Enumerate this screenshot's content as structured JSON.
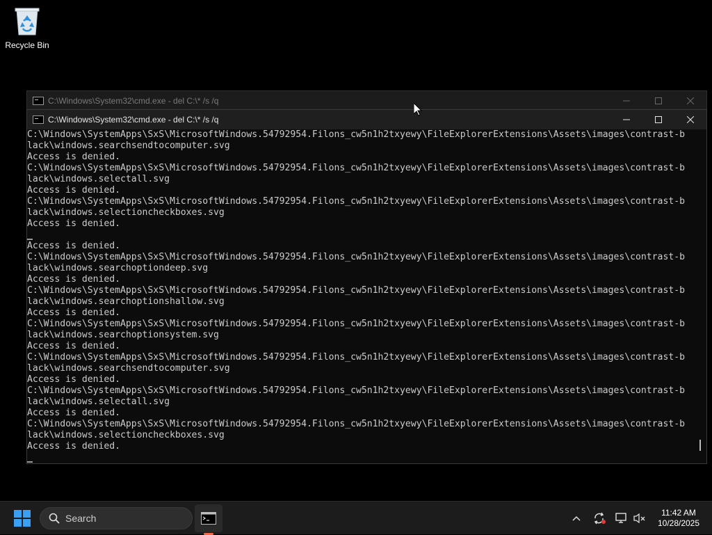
{
  "desktop": {
    "recycle_bin_label": "Recycle Bin"
  },
  "back_window": {
    "title": "C:\\Windows\\System32\\cmd.exe - del  C:\\* /s /q"
  },
  "front_window": {
    "title": "C:\\Windows\\System32\\cmd.exe - del  C:\\* /s /q",
    "lines": [
      "C:\\Windows\\SystemApps\\SxS\\MicrosoftWindows.54792954.Filons_cw5n1h2txyewy\\FileExplorerExtensions\\Assets\\images\\contrast-b",
      "lack\\windows.searchsendtocomputer.svg",
      "Access is denied.",
      "C:\\Windows\\SystemApps\\SxS\\MicrosoftWindows.54792954.Filons_cw5n1h2txyewy\\FileExplorerExtensions\\Assets\\images\\contrast-b",
      "lack\\windows.selectall.svg",
      "Access is denied.",
      "C:\\Windows\\SystemApps\\SxS\\MicrosoftWindows.54792954.Filons_cw5n1h2txyewy\\FileExplorerExtensions\\Assets\\images\\contrast-b",
      "lack\\windows.selectioncheckboxes.svg",
      "Access is denied.",
      "",
      "Access is denied.",
      "C:\\Windows\\SystemApps\\SxS\\MicrosoftWindows.54792954.Filons_cw5n1h2txyewy\\FileExplorerExtensions\\Assets\\images\\contrast-b",
      "lack\\windows.searchoptiondeep.svg",
      "Access is denied.",
      "C:\\Windows\\SystemApps\\SxS\\MicrosoftWindows.54792954.Filons_cw5n1h2txyewy\\FileExplorerExtensions\\Assets\\images\\contrast-b",
      "lack\\windows.searchoptionshallow.svg",
      "Access is denied.",
      "C:\\Windows\\SystemApps\\SxS\\MicrosoftWindows.54792954.Filons_cw5n1h2txyewy\\FileExplorerExtensions\\Assets\\images\\contrast-b",
      "lack\\windows.searchoptionsystem.svg",
      "Access is denied.",
      "C:\\Windows\\SystemApps\\SxS\\MicrosoftWindows.54792954.Filons_cw5n1h2txyewy\\FileExplorerExtensions\\Assets\\images\\contrast-b",
      "lack\\windows.searchsendtocomputer.svg",
      "Access is denied.",
      "C:\\Windows\\SystemApps\\SxS\\MicrosoftWindows.54792954.Filons_cw5n1h2txyewy\\FileExplorerExtensions\\Assets\\images\\contrast-b",
      "lack\\windows.selectall.svg",
      "Access is denied.",
      "C:\\Windows\\SystemApps\\SxS\\MicrosoftWindows.54792954.Filons_cw5n1h2txyewy\\FileExplorerExtensions\\Assets\\images\\contrast-b",
      "lack\\windows.selectioncheckboxes.svg",
      "Access is denied."
    ]
  },
  "taskbar": {
    "search_placeholder": "Search",
    "time": "11:42 AM",
    "date": "10/28/2025",
    "icons": [
      "windows-start-icon",
      "search-icon",
      "terminal-icon",
      "chevron-up-icon",
      "sync-icon",
      "display-icon",
      "speaker-muted-icon"
    ],
    "accent_indicator": "#f06a4a"
  }
}
